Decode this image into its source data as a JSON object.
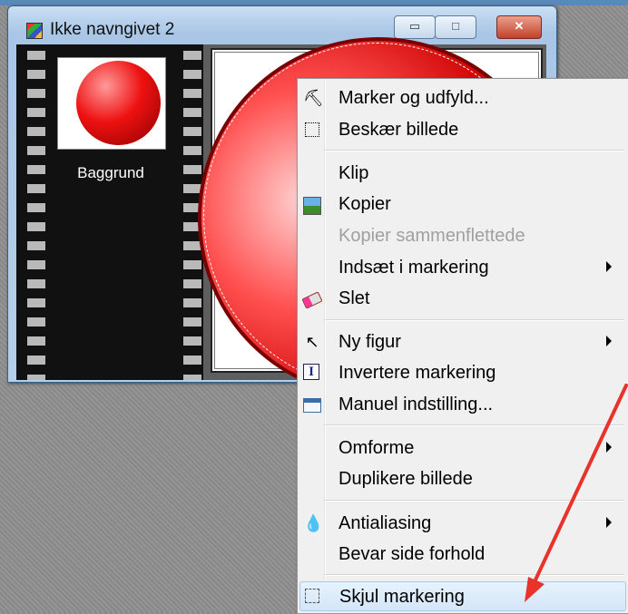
{
  "window": {
    "title": "Ikke navngivet 2",
    "minimize_glyph": "▭",
    "maximize_glyph": "□",
    "close_glyph": "✕"
  },
  "layers": [
    {
      "label": "Baggrund"
    }
  ],
  "context_menu": {
    "items": [
      {
        "label": "Marker og udfyld...",
        "icon": "fill-select-icon"
      },
      {
        "label": "Beskær billede",
        "icon": "crop-icon"
      },
      {
        "label": "Klip",
        "icon": ""
      },
      {
        "label": "Kopier",
        "icon": "copy-icon"
      },
      {
        "label": "Kopier sammenflettede",
        "icon": "",
        "disabled": true
      },
      {
        "label": "Indsæt i markering",
        "icon": "",
        "submenu": true
      },
      {
        "label": "Slet",
        "icon": "eraser-icon"
      },
      {
        "label": "Ny figur",
        "icon": "cursor-icon",
        "submenu": true
      },
      {
        "label": "Invertere markering",
        "icon": "invert-icon"
      },
      {
        "label": "Manuel indstilling...",
        "icon": "manual-settings-icon"
      },
      {
        "label": "Omforme",
        "icon": "",
        "submenu": true
      },
      {
        "label": "Duplikere billede",
        "icon": ""
      },
      {
        "label": "Antialiasing",
        "icon": "drop-icon",
        "submenu": true
      },
      {
        "label": "Bevar side forhold",
        "icon": ""
      },
      {
        "label": "Skjul markering",
        "icon": "hide-selection-icon",
        "highlighted": true
      }
    ]
  },
  "colors": {
    "annotation_arrow": "#e8322a",
    "highlight_border": "#a6c9ee",
    "ball": "#ee1111"
  }
}
